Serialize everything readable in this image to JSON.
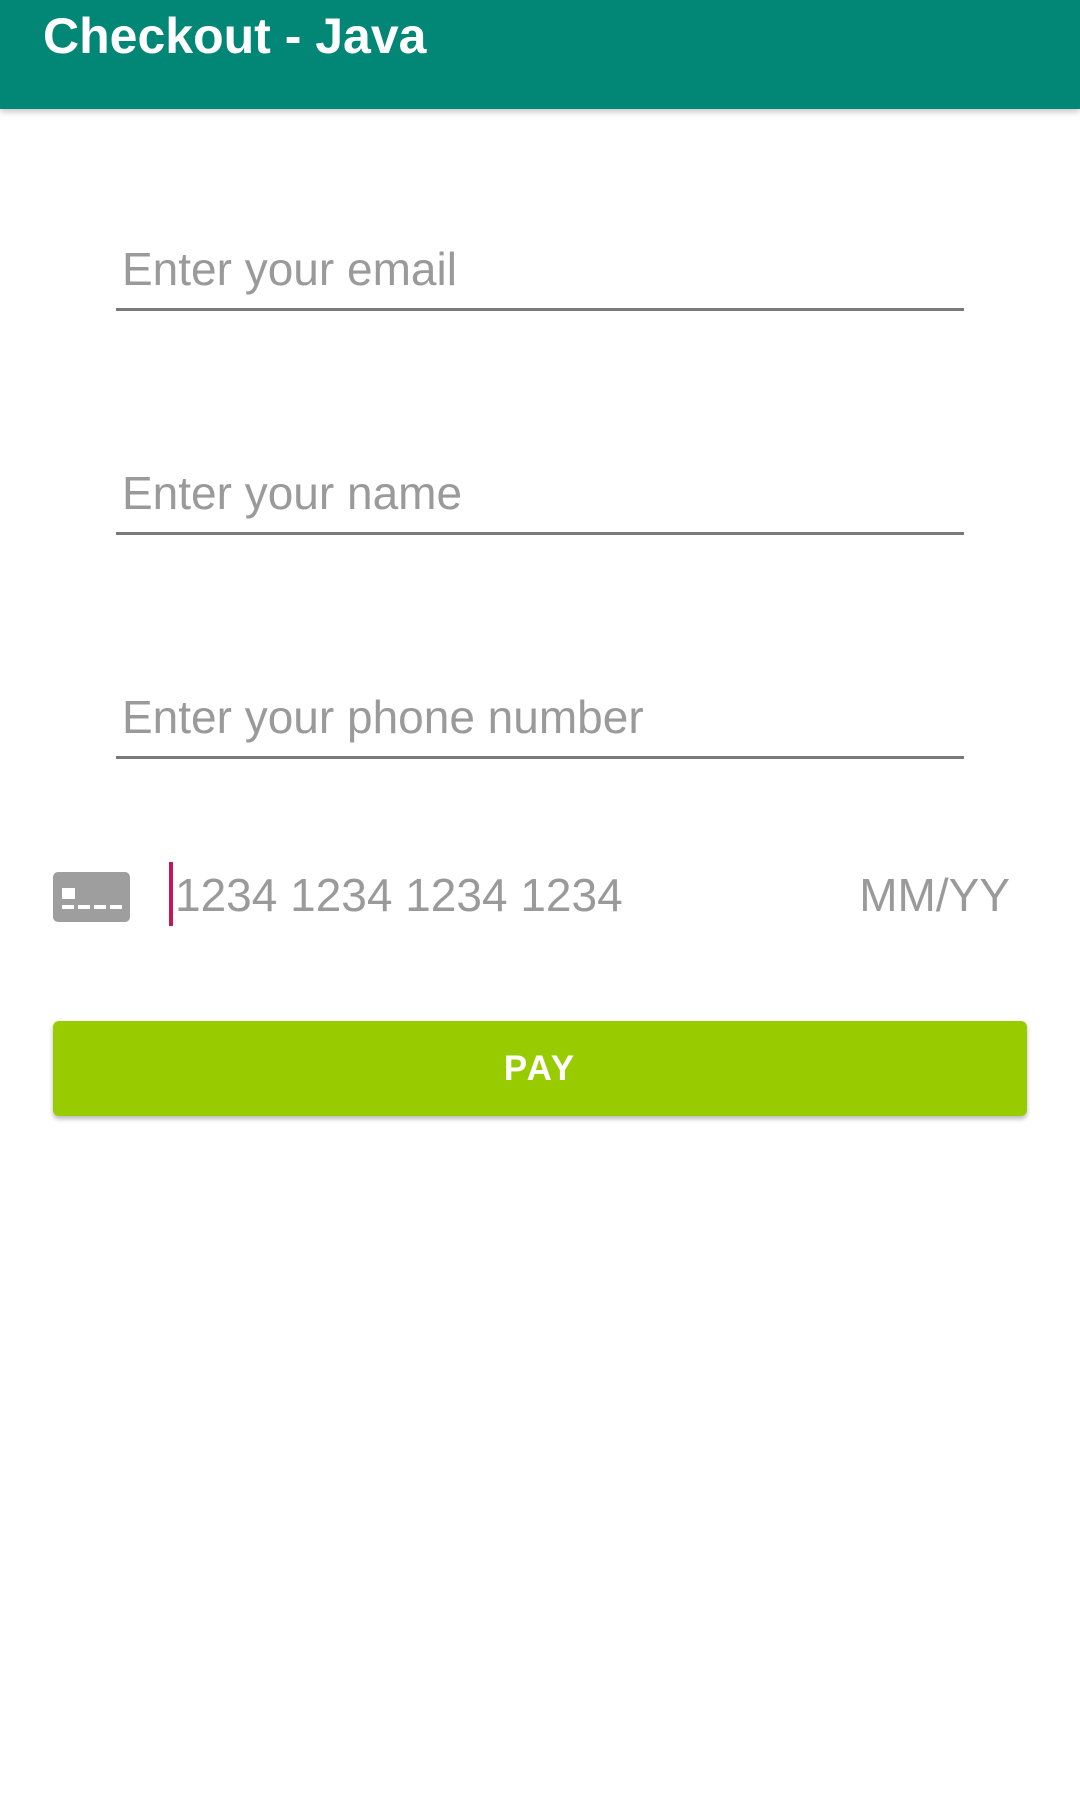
{
  "app_bar": {
    "title": "Checkout - Java"
  },
  "form": {
    "email_placeholder": "Enter your email",
    "name_placeholder": "Enter your name",
    "phone_placeholder": "Enter your phone number"
  },
  "card_input": {
    "icon": "credit-card-icon",
    "number_placeholder": "1234 1234 1234 1234",
    "expiry_placeholder": "MM/YY"
  },
  "pay_button": {
    "label": "PAY"
  },
  "colors": {
    "primary": "#028676",
    "accent": "#c2185b",
    "pay_button": "#99cc00",
    "placeholder": "#9a9a9a",
    "icon_gray": "#9e9e9e"
  }
}
